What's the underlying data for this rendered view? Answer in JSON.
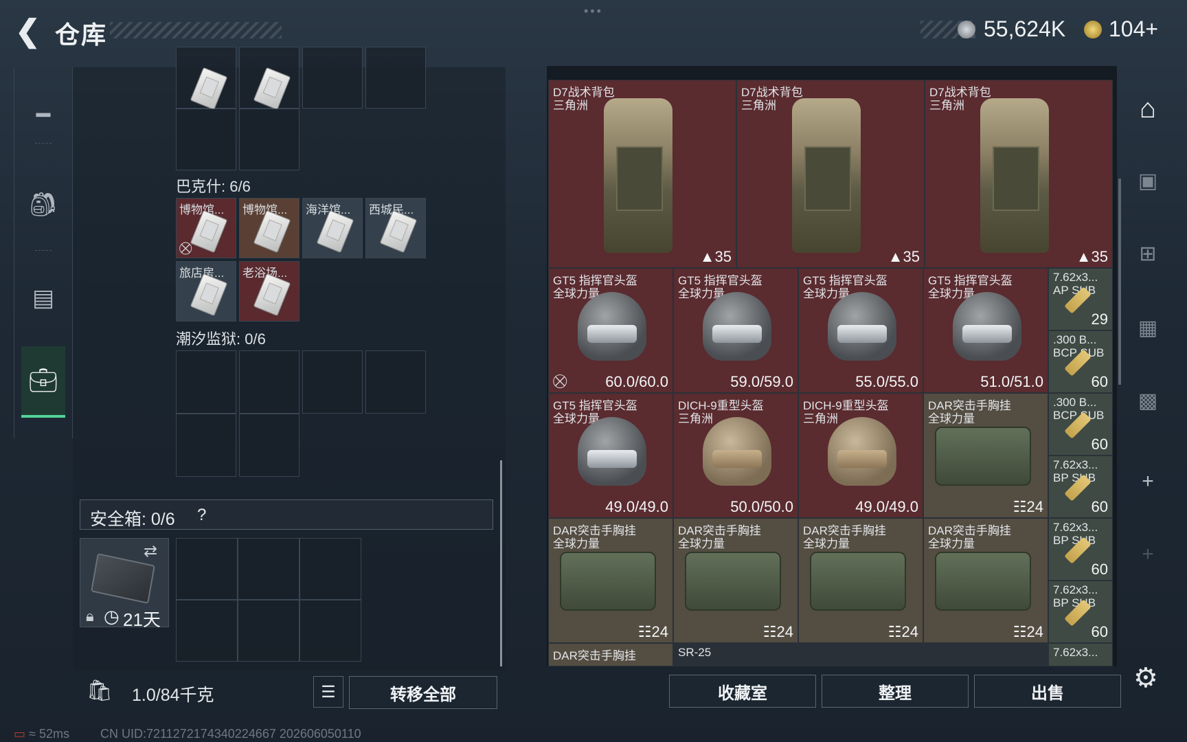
{
  "header": {
    "title": "仓库",
    "currency_primary": "55,624K",
    "currency_secondary": "104+"
  },
  "nav": {
    "items": [
      "weapons",
      "backpack",
      "armor",
      "case"
    ]
  },
  "storage": {
    "bakeshi_label": "巴克什: 6/6",
    "bakeshi_slots": [
      "博物馆...",
      "博物馆...",
      "海洋馆...",
      "西城民...",
      "旅店房...",
      "老浴场..."
    ],
    "chaoxi_label": "潮汐监狱: 0/6"
  },
  "safebox": {
    "label": "安全箱: 0/6",
    "help": "?",
    "days": "21天"
  },
  "bottom_left": {
    "weight": "1.0/84千克",
    "transfer_all": "转移全部"
  },
  "bottom_right": {
    "collection": "收藏室",
    "sort": "整理",
    "sell": "出售"
  },
  "grid": {
    "backpacks": [
      {
        "name": "D7战术背包",
        "src": "三角洲",
        "val": "35"
      },
      {
        "name": "D7战术背包",
        "src": "三角洲",
        "val": "35"
      },
      {
        "name": "D7战术背包",
        "src": "三角洲",
        "val": "35"
      }
    ],
    "row2": [
      {
        "name": "GT5 指挥官头盔",
        "src": "全球力量",
        "val": "60.0/60.0"
      },
      {
        "name": "GT5 指挥官头盔",
        "src": "全球力量",
        "val": "59.0/59.0"
      },
      {
        "name": "GT5 指挥官头盔",
        "src": "全球力量",
        "val": "55.0/55.0"
      },
      {
        "name": "GT5 指挥官头盔",
        "src": "全球力量",
        "val": "51.0/51.0"
      }
    ],
    "row3": [
      {
        "name": "GT5 指挥官头盔",
        "src": "全球力量",
        "val": "49.0/49.0"
      },
      {
        "name": "DICH-9重型头盔",
        "src": "三角洲",
        "val": "50.0/50.0"
      },
      {
        "name": "DICH-9重型头盔",
        "src": "三角洲",
        "val": "49.0/49.0"
      },
      {
        "name": "DAR突击手胸挂",
        "src": "全球力量",
        "val": "24"
      }
    ],
    "row4": [
      {
        "name": "DAR突击手胸挂",
        "src": "全球力量",
        "val": "24"
      },
      {
        "name": "DAR突击手胸挂",
        "src": "全球力量",
        "val": "24"
      },
      {
        "name": "DAR突击手胸挂",
        "src": "全球力量",
        "val": "24"
      },
      {
        "name": "DAR突击手胸挂",
        "src": "全球力量",
        "val": "24"
      }
    ],
    "ammo": [
      {
        "name": "7.62x3...",
        "type": "AP SUB",
        "val": "29"
      },
      {
        "name": ".300 B...",
        "type": "BCP SUB",
        "val": "60"
      },
      {
        "name": ".300 B...",
        "type": "BCP SUB",
        "val": "60"
      },
      {
        "name": "7.62x3...",
        "type": "BP SUB",
        "val": "60"
      },
      {
        "name": "7.62x3...",
        "type": "BP SUB",
        "val": "60"
      },
      {
        "name": "7.62x3...",
        "type": "BP SUB",
        "val": "60"
      }
    ],
    "partial_row": [
      "DAR突击手胸挂",
      "SR-25",
      "7.62x3..."
    ]
  },
  "status": {
    "ping": "52ms",
    "uid": "CN UID:7211272174340224667 202606050110"
  },
  "colors": {
    "accent": "#52d29a",
    "cell_red": "#5a2b2f",
    "cell_gray": "#544d42"
  }
}
